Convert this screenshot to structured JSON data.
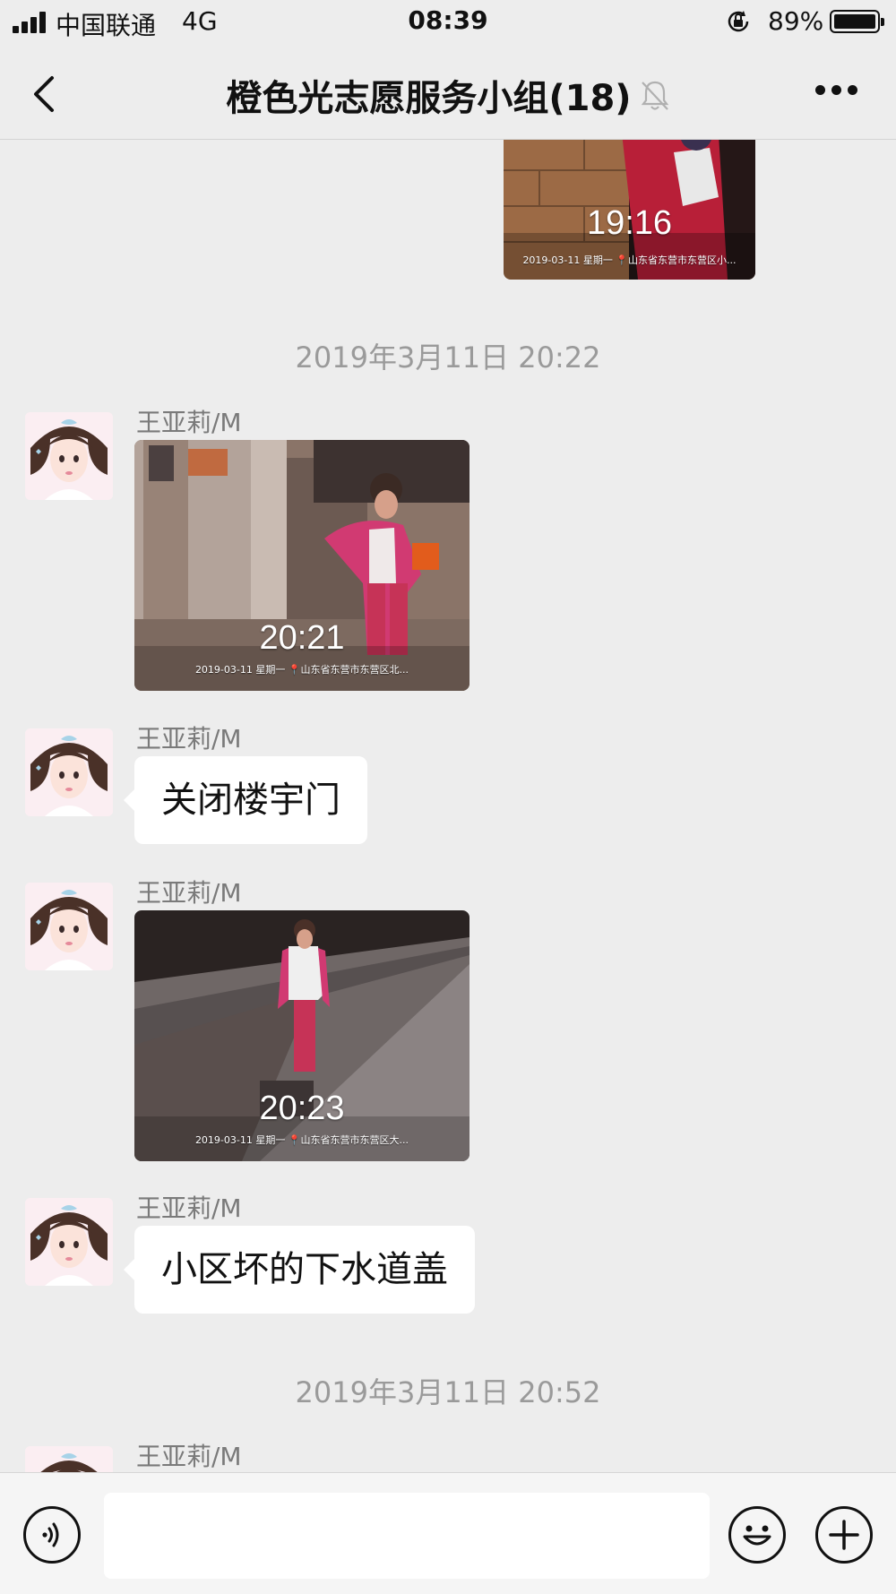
{
  "status_bar": {
    "carrier": "中国联通",
    "network": "4G",
    "time": "08:39",
    "battery": "89%",
    "battery_level": 0.89
  },
  "header": {
    "title": "橙色光志愿服务小组(18)",
    "icons": [
      "back-icon",
      "mute-bell-icon",
      "more-icon"
    ]
  },
  "chat": {
    "top_photo": {
      "time": "19:16",
      "caption": "2019-03-11 星期一 📍山东省东营市东营区小..."
    },
    "separators": [
      "2019年3月11日 20:22",
      "2019年3月11日 20:52"
    ],
    "messages": [
      {
        "sender": "王亚莉/M",
        "type": "image",
        "photo_time": "20:21",
        "caption": "2019-03-11 星期一 📍山东省东营市东营区北..."
      },
      {
        "sender": "王亚莉/M",
        "type": "text",
        "text": "关闭楼宇门"
      },
      {
        "sender": "王亚莉/M",
        "type": "image",
        "photo_time": "20:23",
        "caption": "2019-03-11 星期一 📍山东省东营市东营区大..."
      },
      {
        "sender": "王亚莉/M",
        "type": "text",
        "text": "小区坏的下水道盖"
      },
      {
        "sender": "王亚莉/M",
        "type": "partial"
      }
    ]
  },
  "input_bar": {
    "placeholder": "",
    "icons": [
      "voice-icon",
      "emoji-icon",
      "plus-icon"
    ]
  }
}
